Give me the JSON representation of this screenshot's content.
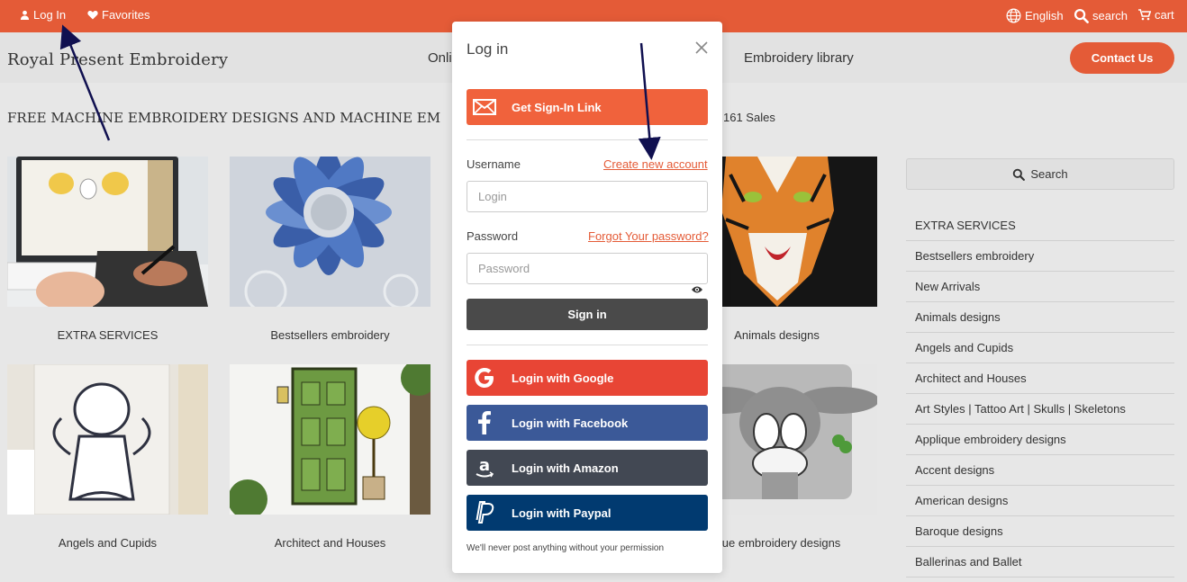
{
  "topbar": {
    "login": "Log In",
    "favorites": "Favorites",
    "language": "English",
    "search": "search",
    "cart": "cart"
  },
  "header": {
    "logo": "Royal Present Embroidery",
    "nav": [
      "Onli",
      "Embroidery library"
    ],
    "contact": "Contact Us"
  },
  "content": {
    "heading": "FREE MACHINE EMBROIDERY DESIGNS AND MACHINE EM",
    "sales": "161 Sales",
    "cards": [
      {
        "caption": "EXTRA SERVICES"
      },
      {
        "caption": "Bestsellers embroidery"
      },
      {
        "caption": "Animals designs"
      },
      {
        "caption": "Angels and Cupids"
      },
      {
        "caption": "Architect and Houses"
      },
      {
        "caption": "ique embroidery designs"
      }
    ]
  },
  "sidebar": {
    "search_label": "Search",
    "categories": [
      "EXTRA SERVICES",
      "Bestsellers embroidery",
      "New Arrivals",
      "Animals designs",
      "Angels and Cupids",
      "Architect and Houses",
      "Art Styles | Tattoo Art | Skulls | Skeletons",
      "Applique embroidery designs",
      "Accent designs",
      "American designs",
      "Baroque designs",
      "Ballerinas and Ballet"
    ]
  },
  "modal": {
    "title": "Log in",
    "signin_link": "Get Sign-In Link",
    "username_label": "Username",
    "create_account": "Create new account",
    "username_placeholder": "Login",
    "password_label": "Password",
    "forgot": "Forgot Your password?",
    "password_placeholder": "Password",
    "signin": "Sign in",
    "google": "Login with Google",
    "facebook": "Login with Facebook",
    "amazon": "Login with Amazon",
    "paypal": "Login with Paypal",
    "note": "We'll never post anything without your permission"
  },
  "colors": {
    "accent": "#e45b37",
    "signin_link": "#f0623c",
    "signin": "#4a4a4a",
    "google": "#e84535",
    "facebook": "#3b5998",
    "amazon": "#424853",
    "paypal": "#013a70"
  }
}
